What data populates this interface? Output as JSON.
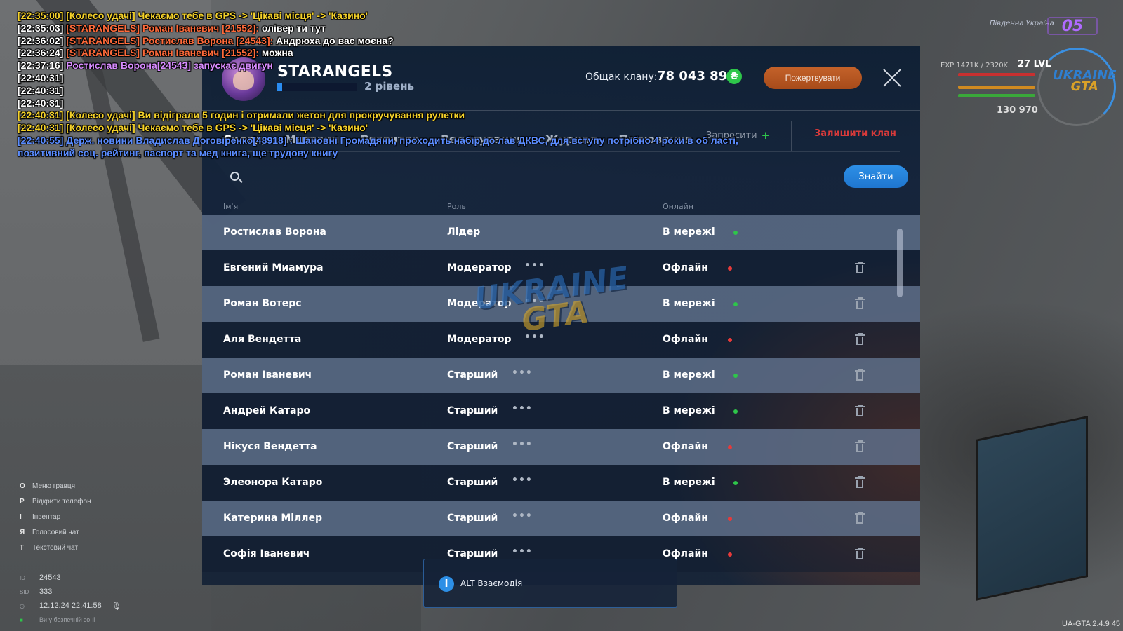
{
  "chat": [
    {
      "color": "c-yellow",
      "text": "[22:35:00] [Колесо удачі] Чекаємо тебе в GPS -> 'Цікаві місця' -> 'Казино'"
    },
    {
      "color": "c-white",
      "text": "[22:35:03] ",
      "seg2": "[STARANGELS] Роман Іваневич [21552]:",
      "seg3": " олівер ти тут"
    },
    {
      "color": "c-white",
      "text": "[22:36:02] ",
      "seg2": "[STARANGELS] Ростислав Ворона [24543]:",
      "seg3": " Андрюха до вас моєна?"
    },
    {
      "color": "c-white",
      "text": "[22:36:24] ",
      "seg2": "[STARANGELS] Роман Іваневич [21552]:",
      "seg3": " можна"
    },
    {
      "color": "c-white",
      "text": "[22:37:16] ",
      "seg2": "",
      "seg3": "",
      "purple": " Ростислав Ворона[24543] запускає двигун"
    },
    {
      "color": "c-white",
      "text": "[22:40:31]"
    },
    {
      "color": "c-white",
      "text": "[22:40:31]"
    },
    {
      "color": "c-white",
      "text": "[22:40:31]"
    },
    {
      "color": "c-yellow",
      "text": "[22:40:31] [Колесо удачі] Ви відіграли 5 годин і отримали жетон для прокручування рулетки"
    },
    {
      "color": "c-yellow",
      "text": "[22:40:31] [Колесо удачі] Чекаємо тебе в GPS -> 'Цікаві місця' -> 'Казино'"
    },
    {
      "color": "c-blue",
      "text": "[22:40:55] Держ. новини Владислав Договіренко[48918] : Шановні Громадяни, проходить набір до лав ДКВС, для вступу потрібно 4 роки в об ласті, позитивний соц. рейтинг, паспорт та мед книга, ще трудову книгу"
    }
  ],
  "hud": {
    "region": "Південна Україна",
    "server": "05",
    "exp": "EXP 1471K / 2320K",
    "lvl": "27 LVL",
    "logo_top": "UKRAINE",
    "logo_bottom": "GTA",
    "money": "130 970"
  },
  "clan": {
    "name": "STARANGELS",
    "level_text": "2 рівень",
    "level_progress": 0.06,
    "balance_label": "Общак клану:",
    "balance_value": "78 043 890",
    "coin_symbol": "₴",
    "donate_label": "Пожертвувати"
  },
  "tabs": [
    {
      "label": "Склад",
      "active": true
    },
    {
      "label": "Магазин",
      "active": false
    },
    {
      "label": "Розвиток",
      "active": false
    },
    {
      "label": "Редагування",
      "active": false
    },
    {
      "label": "Журнал",
      "active": false
    },
    {
      "label": "Полювання",
      "active": false
    }
  ],
  "invite_label": "Запросити",
  "leave_label": "Залишити клан",
  "search": {
    "placeholder": "",
    "button": "Знайти"
  },
  "columns": {
    "name": "Ім'я",
    "role": "Роль",
    "online": "Онлайн"
  },
  "members": [
    {
      "name": "Ростислав Ворона",
      "role": "Лідер",
      "status": "В мережі",
      "online": true,
      "actions": false
    },
    {
      "name": "Евгений Миамура",
      "role": "Модератор",
      "status": "Офлайн",
      "online": false,
      "actions": true
    },
    {
      "name": "Роман Вотерс",
      "role": "Модератор",
      "status": "В мережі",
      "online": true,
      "actions": true
    },
    {
      "name": "Аля Вендетта",
      "role": "Модератор",
      "status": "Офлайн",
      "online": false,
      "actions": true
    },
    {
      "name": "Роман Іваневич",
      "role": "Старший",
      "status": "В мережі",
      "online": true,
      "actions": true
    },
    {
      "name": "Андрей Катаро",
      "role": "Старший",
      "status": "В мережі",
      "online": true,
      "actions": true
    },
    {
      "name": "Нікуся Вендетта",
      "role": "Старший",
      "status": "Офлайн",
      "online": false,
      "actions": true
    },
    {
      "name": "Элеонора Катаро",
      "role": "Старший",
      "status": "В мережі",
      "online": true,
      "actions": true
    },
    {
      "name": "Катерина Міллер",
      "role": "Старший",
      "status": "Офлайн",
      "online": false,
      "actions": true
    },
    {
      "name": "Софія Іваневич",
      "role": "Старший",
      "status": "Офлайн",
      "online": false,
      "actions": true
    }
  ],
  "watermark": {
    "top": "UKRAINE",
    "bottom": "GTA"
  },
  "alt_hint": {
    "icon": "i",
    "text": "ALT Взаємодія"
  },
  "hints": [
    {
      "key": "O",
      "label": "Меню гравця"
    },
    {
      "key": "P",
      "label": "Відкрити телефон"
    },
    {
      "key": "I",
      "label": "Інвентар"
    },
    {
      "key": "Я",
      "label": "Голосовий чат"
    },
    {
      "key": "T",
      "label": "Текстовий чат"
    }
  ],
  "ids": {
    "id_label": "ID",
    "id": "24543",
    "sid_label": "SID",
    "sid": "333",
    "datetime": "12.12.24 22:41:58",
    "zone": "Ви у безпечній зоні"
  },
  "version": "UA-GTA 2.4.9  45",
  "colors": {
    "online": "#2ec64a",
    "offline": "#e83a3a",
    "accent": "#2d8fe6",
    "donate": "#b9572a",
    "leave": "#d83a3a"
  }
}
